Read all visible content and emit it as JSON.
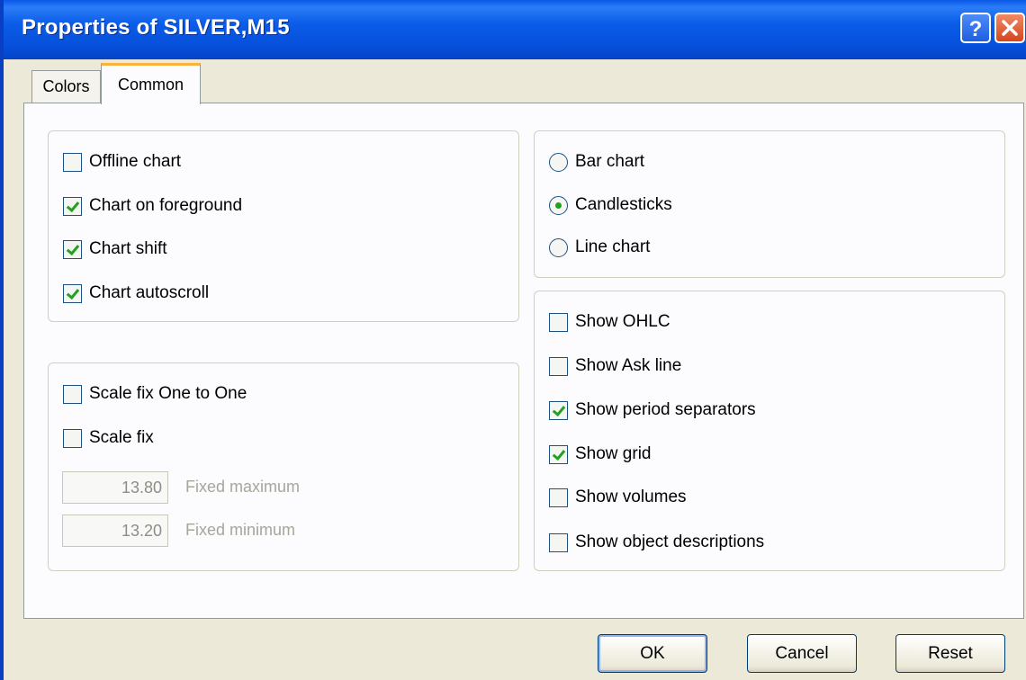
{
  "window": {
    "title": "Properties of SILVER,M15",
    "help_icon": "help-icon",
    "close_icon": "close-icon",
    "titlebar_color": "#0a58e6"
  },
  "tabs": [
    {
      "label": "Colors",
      "active": false
    },
    {
      "label": "Common",
      "active": true
    }
  ],
  "general_options": [
    {
      "label": "Offline chart",
      "checked": false
    },
    {
      "label": "Chart on foreground",
      "checked": true
    },
    {
      "label": "Chart shift",
      "checked": true
    },
    {
      "label": "Chart autoscroll",
      "checked": true
    }
  ],
  "scale_options": {
    "one_to_one": {
      "label": "Scale fix One to One",
      "checked": false
    },
    "scale_fix": {
      "label": "Scale fix",
      "checked": false
    },
    "fixed_maximum": {
      "value": "13.80",
      "label": "Fixed maximum"
    },
    "fixed_minimum": {
      "value": "13.20",
      "label": "Fixed minimum"
    }
  },
  "chart_type": [
    {
      "label": "Bar chart",
      "selected": false
    },
    {
      "label": "Candlesticks",
      "selected": true
    },
    {
      "label": "Line chart",
      "selected": false
    }
  ],
  "display_options": [
    {
      "label": "Show OHLC",
      "checked": false
    },
    {
      "label": "Show Ask line",
      "checked": false
    },
    {
      "label": "Show period separators",
      "checked": true
    },
    {
      "label": "Show grid",
      "checked": true
    },
    {
      "label": "Show volumes",
      "checked": false
    },
    {
      "label": "Show object descriptions",
      "checked": false
    }
  ],
  "buttons": {
    "ok": "OK",
    "cancel": "Cancel",
    "reset": "Reset"
  },
  "colors": {
    "check_mark": "#21a121",
    "active_tab_accent": "#f9b23c"
  }
}
